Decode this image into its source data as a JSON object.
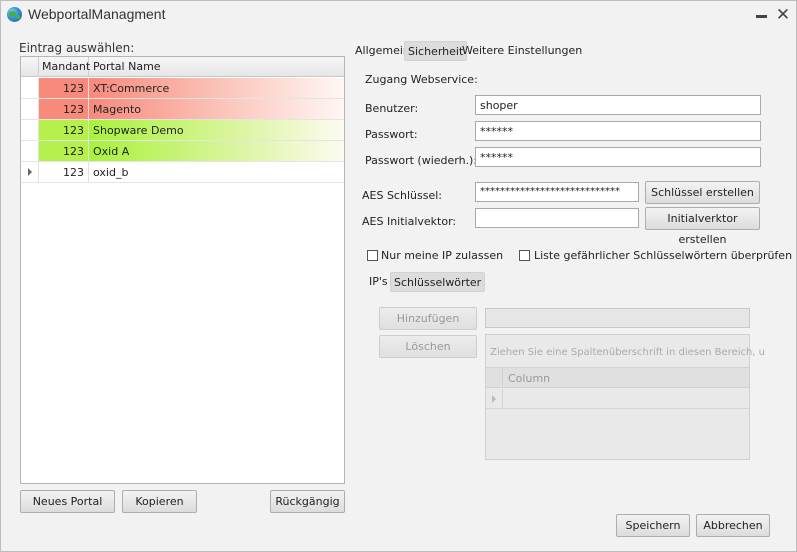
{
  "window": {
    "title": "WebportalManagment",
    "minimize_symbol": "—",
    "close_symbol": "✕"
  },
  "left": {
    "title": "Eintrag auswählen:",
    "columns": {
      "mandant": "Mandant",
      "portal_name": "Portal Name"
    },
    "rows": [
      {
        "mandant": "123",
        "name": "XT:Commerce",
        "color": "red"
      },
      {
        "mandant": "123",
        "name": "Magento",
        "color": "red"
      },
      {
        "mandant": "123",
        "name": "Shopware Demo",
        "color": "green"
      },
      {
        "mandant": "123",
        "name": "Oxid A",
        "color": "green"
      },
      {
        "mandant": "123",
        "name": "oxid_b",
        "color": "none",
        "current": true
      }
    ],
    "buttons": {
      "new": "Neues Portal",
      "copy": "Kopieren",
      "undo": "Rückgängig"
    }
  },
  "tabs": [
    "Allgemein",
    "Sicherheit",
    "Weitere Einstellungen"
  ],
  "active_tab": "Sicherheit",
  "security": {
    "webservice_label": "Zugang Webservice:",
    "user_label": "Benutzer:",
    "user_value": "shoper",
    "password_label": "Passwort:",
    "password_value": "******",
    "password_repeat_label": "Passwort  (wiederh.):",
    "password_repeat_value": "******",
    "aes_key_label": "AES Schlüssel:",
    "aes_key_value": "****************************",
    "aes_key_button": "Schlüssel erstellen",
    "aes_iv_label": "AES Initialvektor:",
    "aes_iv_value": "",
    "aes_iv_button": "Initialverktor erstellen",
    "only_my_ip_label": "Nur meine IP zulassen",
    "only_my_ip_checked": false,
    "check_keywords_label": "Liste gefährlicher Schlüsselwörtern überprüfen",
    "check_keywords_checked": false,
    "subtabs": [
      "IP's",
      "Schlüsselwörter"
    ],
    "active_subtab": "Schlüsselwörter",
    "add_button": "Hinzufügen",
    "delete_button": "Löschen",
    "group_panel_text": "Ziehen Sie eine Spaltenüberschrift in diesen Bereich, u",
    "column_header": "Column"
  },
  "footer": {
    "save": "Speichern",
    "cancel": "Abbrechen"
  },
  "colors": {
    "row_red": "#f88a7c",
    "row_green": "#b6f04c",
    "background": "#f2f2f2"
  }
}
